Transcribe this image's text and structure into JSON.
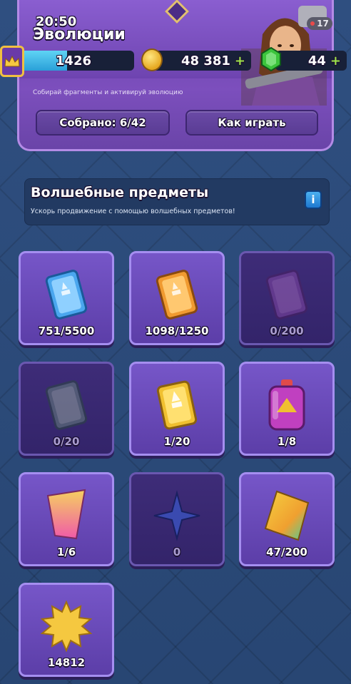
{
  "status_bar": {
    "time": "20:50"
  },
  "header": {
    "title": "Эволюции",
    "level": "17",
    "subtitle": "Собирай фрагменты и активируй эволюцию",
    "trophies": "1426",
    "trophy_progress": 0.46,
    "gold": "48 381",
    "gold_plus": "+",
    "gems": "44",
    "gems_plus": "+",
    "collected_button": "Собрано: 6/42",
    "how_to_play_button": "Как играть"
  },
  "section": {
    "title": "Волшебные предметы",
    "subtitle": "Ускорь продвижение с помощью волшебных предметов!",
    "info_label": "i"
  },
  "items": [
    {
      "icon": "blue-book-icon",
      "count": "751/5500",
      "color": "#4aa6ee",
      "dim": false
    },
    {
      "icon": "orange-book-icon",
      "count": "1098/1250",
      "color": "#f09a30",
      "dim": false
    },
    {
      "icon": "purple-book-icon",
      "count": "0/200",
      "color": "#8a4aa8",
      "dim": true
    },
    {
      "icon": "green-book-icon",
      "count": "0/20",
      "color": "#6a8a7a",
      "dim": true
    },
    {
      "icon": "gold-book-icon",
      "count": "1/20",
      "color": "#f0c030",
      "dim": false
    },
    {
      "icon": "wild-card-potion-icon",
      "count": "1/8",
      "color": "#c040c0",
      "dim": false
    },
    {
      "icon": "evolution-shard-icon",
      "count": "1/6",
      "color": "#f070a0",
      "dim": false
    },
    {
      "icon": "star-shard-icon",
      "count": "0",
      "color": "#3a4ab0",
      "dim": false
    },
    {
      "icon": "rainbow-shard-icon",
      "count": "47/200",
      "color": "#f0b030",
      "dim": false
    },
    {
      "icon": "star-points-icon",
      "count": "14812",
      "color": "#f5c840",
      "dim": false
    }
  ]
}
